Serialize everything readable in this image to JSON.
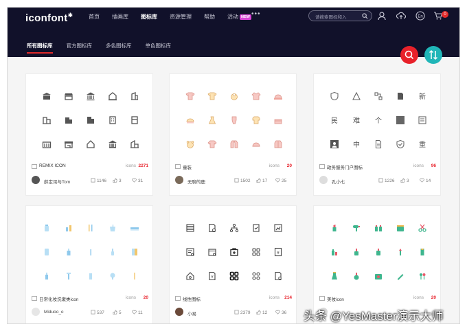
{
  "header": {
    "logo": "iconfont",
    "nav": [
      {
        "label": "首页",
        "active": false
      },
      {
        "label": "插画库",
        "active": false
      },
      {
        "label": "图标库",
        "active": true
      },
      {
        "label": "资源管理",
        "active": false
      },
      {
        "label": "帮助",
        "active": false
      },
      {
        "label": "活动",
        "active": false,
        "badge": "NEW"
      }
    ],
    "more": "•••",
    "search_placeholder": "请搜索图标和入",
    "cart_count": "0",
    "lang_icon": "En"
  },
  "subnav": [
    {
      "label": "所有图标库",
      "active": true
    },
    {
      "label": "官方图标库",
      "active": false
    },
    {
      "label": "多色图标库",
      "active": false
    },
    {
      "label": "单色图标库",
      "active": false
    }
  ],
  "colors": {
    "accent": "#e8212a",
    "teal": "#20b6b8",
    "header_bg": "#11112a"
  },
  "cards": [
    {
      "title": "REMIX ICON",
      "icons_label": "icons",
      "count": "2271",
      "author": "薛定谔与Tom",
      "views": "1146",
      "likes": "3",
      "favs": "31",
      "icon_style": "dark"
    },
    {
      "title": "童装",
      "icons_label": "icons",
      "count": "20",
      "author": "无聊的鹿",
      "views": "1502",
      "likes": "17",
      "favs": "25",
      "icon_style": "pink"
    },
    {
      "title": "政务服务门户图标",
      "icons_label": "icons",
      "count": "96",
      "author": "孔小七",
      "views": "1226",
      "likes": "3",
      "favs": "14",
      "icon_style": "gray"
    },
    {
      "title": "日常化妆洗漱类icon",
      "icons_label": "icons",
      "count": "20",
      "author": "Miduoo_o",
      "views": "537",
      "likes": "5",
      "favs": "11",
      "icon_style": "blue"
    },
    {
      "title": "线性图标",
      "icons_label": "icons",
      "count": "214",
      "author": "小易",
      "views": "2379",
      "likes": "12",
      "favs": "36",
      "icon_style": "outline"
    },
    {
      "title": "美妆icon",
      "icons_label": "icons",
      "count": "20",
      "author": "",
      "views": "",
      "likes": "",
      "favs": "",
      "icon_style": "green"
    }
  ],
  "watermark": "头条 @YesMaster演示大师"
}
